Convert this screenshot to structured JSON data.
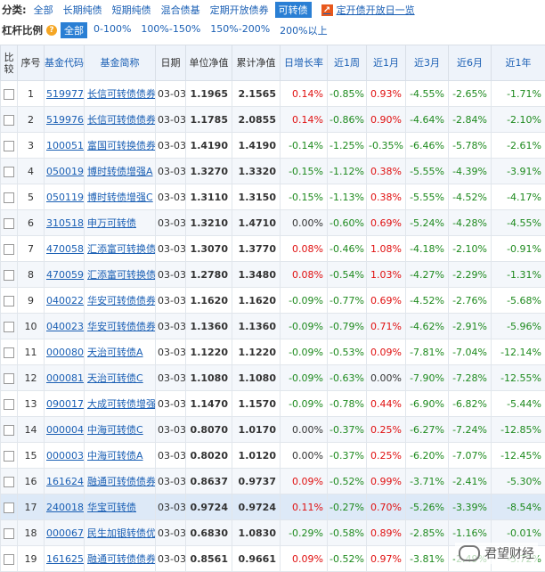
{
  "filters": {
    "category_label": "分类:",
    "categories": [
      "全部",
      "长期纯债",
      "短期纯债",
      "混合债基",
      "定期开放债券",
      "可转债"
    ],
    "active_category": 5,
    "open_day_link": "定开债开放日一览",
    "leverage_label": "杠杆比例",
    "leverage_options": [
      "全部",
      "0-100%",
      "100%-150%",
      "150%-200%",
      "200%以上"
    ],
    "active_leverage": 0
  },
  "table": {
    "headers": [
      "比较",
      "序号",
      "基金代码",
      "基金简称",
      "日期",
      "单位净值",
      "累计净值",
      "日增长率",
      "近1周",
      "近1月",
      "近3月",
      "近6月",
      "近1年"
    ],
    "rows": [
      [
        "1",
        "519977",
        "长信可转债债券A",
        "03-03",
        "1.1965",
        "2.1565",
        "0.14%",
        "-0.85%",
        "0.93%",
        "-4.55%",
        "-2.65%",
        "-1.71%"
      ],
      [
        "2",
        "519976",
        "长信可转债债券C",
        "03-03",
        "1.1785",
        "2.0855",
        "0.14%",
        "-0.86%",
        "0.90%",
        "-4.64%",
        "-2.84%",
        "-2.10%"
      ],
      [
        "3",
        "100051",
        "富国可转换债券",
        "03-03",
        "1.4190",
        "1.4190",
        "-0.14%",
        "-1.25%",
        "-0.35%",
        "-6.46%",
        "-5.78%",
        "-2.61%"
      ],
      [
        "4",
        "050019",
        "博时转债增强A",
        "03-03",
        "1.3270",
        "1.3320",
        "-0.15%",
        "-1.12%",
        "0.38%",
        "-5.55%",
        "-4.39%",
        "-3.91%"
      ],
      [
        "5",
        "050119",
        "博时转债增强C",
        "03-03",
        "1.3110",
        "1.3150",
        "-0.15%",
        "-1.13%",
        "0.38%",
        "-5.55%",
        "-4.52%",
        "-4.17%"
      ],
      [
        "6",
        "310518",
        "申万可转债",
        "03-03",
        "1.3210",
        "1.4710",
        "0.00%",
        "-0.60%",
        "0.69%",
        "-5.24%",
        "-4.28%",
        "-4.55%"
      ],
      [
        "7",
        "470058",
        "汇添富可转换债券A",
        "03-03",
        "1.3070",
        "1.3770",
        "0.08%",
        "-0.46%",
        "1.08%",
        "-4.18%",
        "-2.10%",
        "-0.91%"
      ],
      [
        "8",
        "470059",
        "汇添富可转换债券C",
        "03-03",
        "1.2780",
        "1.3480",
        "0.08%",
        "-0.54%",
        "1.03%",
        "-4.27%",
        "-2.29%",
        "-1.31%"
      ],
      [
        "9",
        "040022",
        "华安可转债债券A",
        "03-03",
        "1.1620",
        "1.1620",
        "-0.09%",
        "-0.77%",
        "0.69%",
        "-4.52%",
        "-2.76%",
        "-5.68%"
      ],
      [
        "10",
        "040023",
        "华安可转债债券B",
        "03-03",
        "1.1360",
        "1.1360",
        "-0.09%",
        "-0.79%",
        "0.71%",
        "-4.62%",
        "-2.91%",
        "-5.96%"
      ],
      [
        "11",
        "000080",
        "天治可转债A",
        "03-03",
        "1.1220",
        "1.1220",
        "-0.09%",
        "-0.53%",
        "0.09%",
        "-7.81%",
        "-7.04%",
        "-12.14%"
      ],
      [
        "12",
        "000081",
        "天治可转债C",
        "03-03",
        "1.1080",
        "1.1080",
        "-0.09%",
        "-0.63%",
        "0.00%",
        "-7.90%",
        "-7.28%",
        "-12.55%"
      ],
      [
        "13",
        "090017",
        "大成可转债增强",
        "03-03",
        "1.1470",
        "1.1570",
        "-0.09%",
        "-0.78%",
        "0.44%",
        "-6.90%",
        "-6.82%",
        "-5.44%"
      ],
      [
        "14",
        "000004",
        "中海可转债C",
        "03-03",
        "0.8070",
        "1.0170",
        "0.00%",
        "-0.37%",
        "0.25%",
        "-6.27%",
        "-7.24%",
        "-12.85%"
      ],
      [
        "15",
        "000003",
        "中海可转债A",
        "03-03",
        "0.8020",
        "1.0120",
        "0.00%",
        "-0.37%",
        "0.25%",
        "-6.20%",
        "-7.07%",
        "-12.45%"
      ],
      [
        "16",
        "161624",
        "融通可转债债券",
        "03-03",
        "0.8637",
        "0.9737",
        "0.09%",
        "-0.52%",
        "0.99%",
        "-3.71%",
        "-2.41%",
        "-5.30%"
      ],
      [
        "17",
        "240018",
        "华宝可转债",
        "03-03",
        "0.9724",
        "0.9724",
        "0.11%",
        "-0.27%",
        "0.70%",
        "-5.26%",
        "-3.39%",
        "-8.54%"
      ],
      [
        "18",
        "000067",
        "民生加银转债优选",
        "03-03",
        "0.6830",
        "1.0830",
        "-0.29%",
        "-0.58%",
        "0.89%",
        "-2.85%",
        "-1.16%",
        "-0.01%"
      ],
      [
        "19",
        "161625",
        "融通可转债债券",
        "03-03",
        "0.8561",
        "0.9661",
        "0.09%",
        "-0.52%",
        "0.97%",
        "-3.81%",
        "-2.49%",
        "-5.72%"
      ]
    ],
    "highlight_row": 16
  },
  "watermark": "君望财经",
  "colors": {
    "up": "#e01010",
    "down": "#1e8a1e",
    "link": "#1a5fb4",
    "active": "#2a7fd4",
    "row_highlight": "#dde9f7"
  }
}
